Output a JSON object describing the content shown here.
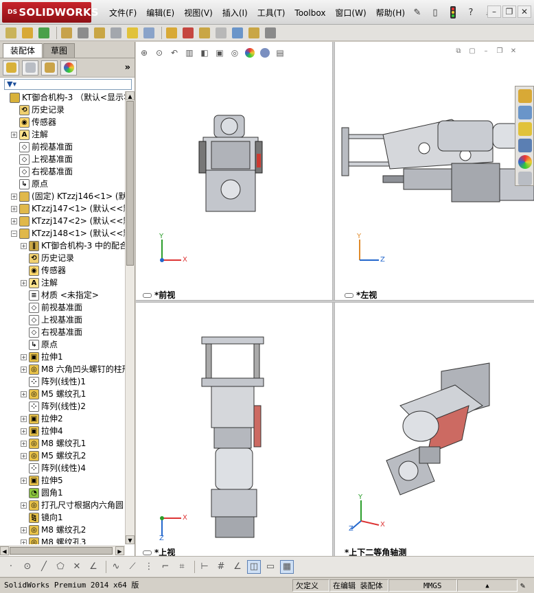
{
  "app": {
    "brand": "SOLIDWORKS",
    "brand_prefix": "DS"
  },
  "menu": [
    "文件(F)",
    "编辑(E)",
    "视图(V)",
    "插入(I)",
    "工具(T)",
    "Toolbox",
    "窗口(W)",
    "帮助(H)"
  ],
  "quick_access": [
    "pin-icon",
    "new-document-icon",
    "traffic-light-icon",
    "help-icon",
    "search-icon"
  ],
  "window_controls": [
    "minimize",
    "restore",
    "close"
  ],
  "panel": {
    "tabs": [
      "装配体",
      "草图"
    ],
    "active_tab": 0
  },
  "manager_tabs": [
    "feature-manager",
    "property-manager",
    "configuration-manager",
    "display-manager"
  ],
  "tree": [
    {
      "label": "KT御合机构-3  （默认<显示状",
      "indent": 0,
      "icon": "assembly",
      "expand": ""
    },
    {
      "label": "历史记录",
      "indent": 1,
      "icon": "history",
      "expand": ""
    },
    {
      "label": "传感器",
      "indent": 1,
      "icon": "sensor",
      "expand": ""
    },
    {
      "label": "注解",
      "indent": 1,
      "icon": "annotation",
      "expand": "+"
    },
    {
      "label": "前视基准面",
      "indent": 1,
      "icon": "plane",
      "expand": ""
    },
    {
      "label": "上视基准面",
      "indent": 1,
      "icon": "plane",
      "expand": ""
    },
    {
      "label": "右视基准面",
      "indent": 1,
      "icon": "plane",
      "expand": ""
    },
    {
      "label": "原点",
      "indent": 1,
      "icon": "origin",
      "expand": ""
    },
    {
      "label": "(固定) KTzzj146<1> (默认",
      "indent": 1,
      "icon": "part",
      "expand": "+"
    },
    {
      "label": "KTzzj147<1> (默认<<默认",
      "indent": 1,
      "icon": "part",
      "expand": "+"
    },
    {
      "label": "KTzzj147<2> (默认<<默认",
      "indent": 1,
      "icon": "part",
      "expand": "+"
    },
    {
      "label": "KTzzj148<1> (默认<<默认",
      "indent": 1,
      "icon": "part",
      "expand": "−"
    },
    {
      "label": "KT御合机构-3 中的配合",
      "indent": 2,
      "icon": "mates",
      "expand": "+"
    },
    {
      "label": "历史记录",
      "indent": 2,
      "icon": "history",
      "expand": ""
    },
    {
      "label": "传感器",
      "indent": 2,
      "icon": "sensor",
      "expand": ""
    },
    {
      "label": "注解",
      "indent": 2,
      "icon": "annotation",
      "expand": "+"
    },
    {
      "label": "材质 <未指定>",
      "indent": 2,
      "icon": "material",
      "expand": ""
    },
    {
      "label": "前视基准面",
      "indent": 2,
      "icon": "plane",
      "expand": ""
    },
    {
      "label": "上视基准面",
      "indent": 2,
      "icon": "plane",
      "expand": ""
    },
    {
      "label": "右视基准面",
      "indent": 2,
      "icon": "plane",
      "expand": ""
    },
    {
      "label": "原点",
      "indent": 2,
      "icon": "origin",
      "expand": ""
    },
    {
      "label": "拉伸1",
      "indent": 2,
      "icon": "extrude",
      "expand": "+"
    },
    {
      "label": "M8 六角凹头螺钉的柱形",
      "indent": 2,
      "icon": "hole",
      "expand": "+"
    },
    {
      "label": "阵列(线性)1",
      "indent": 2,
      "icon": "pattern",
      "expand": ""
    },
    {
      "label": "M5 螺纹孔1",
      "indent": 2,
      "icon": "hole",
      "expand": "+"
    },
    {
      "label": "阵列(线性)2",
      "indent": 2,
      "icon": "pattern",
      "expand": ""
    },
    {
      "label": "拉伸2",
      "indent": 2,
      "icon": "extrude",
      "expand": "+"
    },
    {
      "label": "拉伸4",
      "indent": 2,
      "icon": "extrude",
      "expand": "+"
    },
    {
      "label": "M8 螺纹孔1",
      "indent": 2,
      "icon": "hole",
      "expand": "+"
    },
    {
      "label": "M5 螺纹孔2",
      "indent": 2,
      "icon": "hole",
      "expand": "+"
    },
    {
      "label": "阵列(线性)4",
      "indent": 2,
      "icon": "pattern",
      "expand": ""
    },
    {
      "label": "拉伸5",
      "indent": 2,
      "icon": "extrude",
      "expand": "+"
    },
    {
      "label": "圆角1",
      "indent": 2,
      "icon": "fillet",
      "expand": ""
    },
    {
      "label": "打孔尺寸根据内六角圆",
      "indent": 2,
      "icon": "hole",
      "expand": "+"
    },
    {
      "label": "镜向1",
      "indent": 2,
      "icon": "mirror",
      "expand": ""
    },
    {
      "label": "M8 螺纹孔2",
      "indent": 2,
      "icon": "hole",
      "expand": "+"
    },
    {
      "label": "M8 螺纹孔3",
      "indent": 2,
      "icon": "hole",
      "expand": "+"
    }
  ],
  "viewports": [
    {
      "name": "*前视",
      "axes": [
        "Y",
        "X"
      ]
    },
    {
      "name": "*左视",
      "axes": [
        "Y",
        "Z"
      ]
    },
    {
      "name": "*上视",
      "axes": [
        "X",
        "Z"
      ]
    },
    {
      "name": "*上下二等角轴测",
      "axes": [
        "Y",
        "X",
        "Z"
      ]
    }
  ],
  "status": {
    "product": "SolidWorks Premium 2014 x64 版",
    "definition": "欠定义",
    "mode": "在编辑 装配体",
    "units": "MMGS"
  },
  "colors": {
    "brand": "#c8242b",
    "selection": "#cfe0f5",
    "part_metal": "#b9bcc2"
  }
}
